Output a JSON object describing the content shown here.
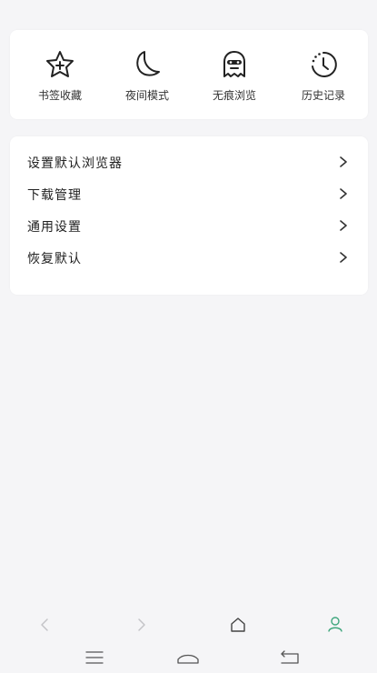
{
  "quick_actions": [
    {
      "label": "书签收藏",
      "icon": "star-plus-icon"
    },
    {
      "label": "夜间模式",
      "icon": "moon-icon"
    },
    {
      "label": "无痕浏览",
      "icon": "incognito-ghost-icon"
    },
    {
      "label": "历史记录",
      "icon": "history-clock-icon"
    }
  ],
  "menu": {
    "items": [
      {
        "label": "设置默认浏览器",
        "icon": "chevron-right-icon"
      },
      {
        "label": "下载管理",
        "icon": "chevron-right-icon"
      },
      {
        "label": "通用设置",
        "icon": "chevron-right-icon"
      },
      {
        "label": "恢复默认",
        "icon": "chevron-right-icon"
      }
    ]
  },
  "bottom_nav": {
    "buttons": [
      {
        "icon": "back-arrow-icon",
        "enabled": false
      },
      {
        "icon": "forward-arrow-icon",
        "enabled": false
      },
      {
        "icon": "home-icon",
        "enabled": true
      },
      {
        "icon": "user-profile-icon",
        "active": true
      }
    ],
    "accent_color": "#3fa67d"
  },
  "system_nav": {
    "buttons": [
      {
        "icon": "menu-lines-icon"
      },
      {
        "icon": "home-gesture-icon"
      },
      {
        "icon": "back-gesture-icon"
      }
    ]
  }
}
